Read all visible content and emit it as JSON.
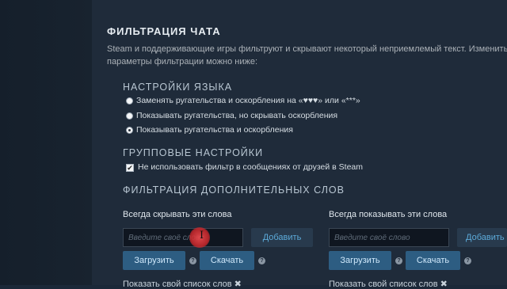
{
  "page": {
    "title": "ФИЛЬТРАЦИЯ ЧАТА",
    "description_line1": "Steam и поддерживающие игры фильтруют и скрывают некоторый неприемлемый текст. Изменить",
    "description_line2": "параметры фильтрации можно ниже:"
  },
  "language": {
    "heading": "НАСТРОЙКИ ЯЗЫКА",
    "options": [
      {
        "label": "Заменять ругательства и оскорбления на «♥♥♥» или «***»",
        "checked": false
      },
      {
        "label": "Показывать ругательства, но скрывать оскорбления",
        "checked": false
      },
      {
        "label": "Показывать ругательства и оскорбления",
        "checked": true
      }
    ]
  },
  "group": {
    "heading": "ГРУППОВЫЕ НАСТРОЙКИ",
    "checkbox_label": "Не использовать фильтр в сообщениях от друзей в Steam",
    "checked": true,
    "check_mark": "✔"
  },
  "words": {
    "heading": "ФИЛЬТРАЦИЯ ДОПОЛНИТЕЛЬНЫХ СЛОВ",
    "block": {
      "label": "Всегда скрывать эти слова",
      "placeholder": "Введите своё слово",
      "add_label": "Добавить",
      "upload_label": "Загрузить",
      "download_label": "Скачать",
      "show_list_label": "Показать свой список слов"
    },
    "allow": {
      "label": "Всегда показывать эти слова",
      "placeholder": "Введите своё слово",
      "add_label": "Добавить",
      "upload_label": "Загрузить",
      "download_label": "Скачать",
      "show_list_label": "Показать свой список слов"
    },
    "help_glyph": "?",
    "expand_glyph": "✖"
  },
  "cursor": {
    "glyph": "I"
  }
}
